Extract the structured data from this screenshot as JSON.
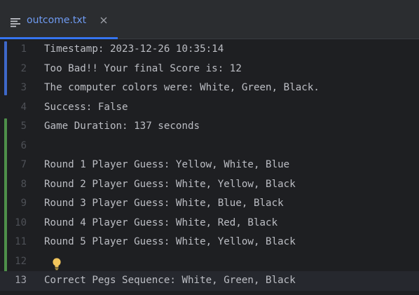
{
  "tab": {
    "title": "outcome.txt",
    "icon": "text-file-icon",
    "close_icon": "close-icon"
  },
  "editor": {
    "current_line": 13,
    "lines": [
      {
        "num": "1",
        "text": "Timestamp: 2023-12-26 10:35:14"
      },
      {
        "num": "2",
        "text": "Too Bad!! Your final Score is: 12"
      },
      {
        "num": "3",
        "text": "The computer colors were: White, Green, Black."
      },
      {
        "num": "4",
        "text": "Success: False"
      },
      {
        "num": "5",
        "text": "Game Duration: 137 seconds"
      },
      {
        "num": "6",
        "text": ""
      },
      {
        "num": "7",
        "text": "Round 1 Player Guess: Yellow, White, Blue"
      },
      {
        "num": "8",
        "text": "Round 2 Player Guess: White, Yellow, Black"
      },
      {
        "num": "9",
        "text": "Round 3 Player Guess: White, Blue, Black"
      },
      {
        "num": "10",
        "text": "Round 4 Player Guess: White, Red, Black"
      },
      {
        "num": "11",
        "text": "Round 5 Player Guess: White, Yellow, Black"
      },
      {
        "num": "12",
        "text": ""
      },
      {
        "num": "13",
        "text": "Correct Pegs Sequence: White, Green, Black"
      }
    ]
  },
  "colors": {
    "background": "#1e1f22",
    "tab_accent": "#3574f0",
    "modified_marker": "#3e68c9",
    "added_marker": "#4e8f4a",
    "bulb": "#f2c55c"
  },
  "intention_icon": "lightbulb-icon"
}
